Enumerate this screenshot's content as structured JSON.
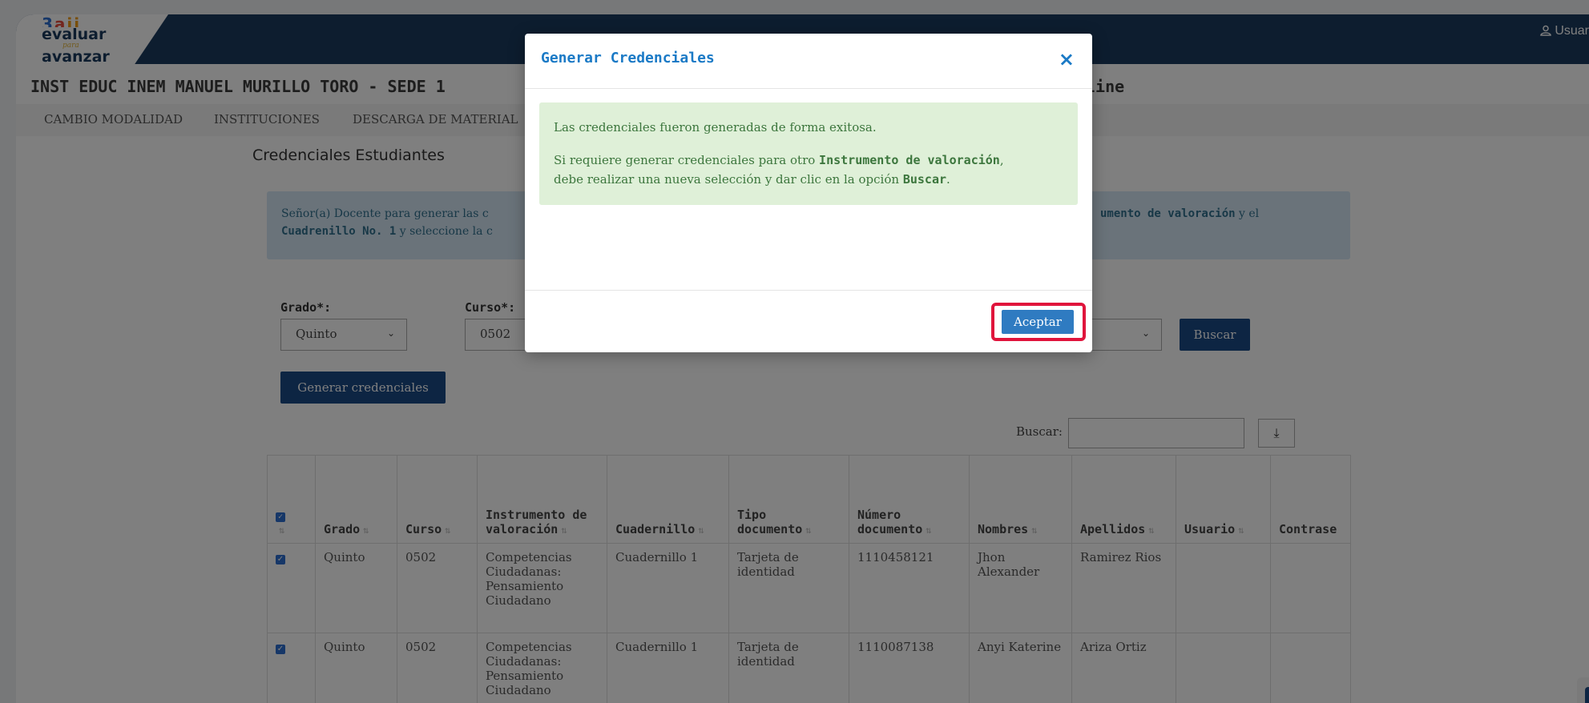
{
  "app": {
    "logo": {
      "dots": "3 a ii",
      "line1": "evaluar",
      "line2": "para",
      "line3": "avanzar"
    },
    "user_label": "Usuar",
    "institution": "INST EDUC INEM MANUEL MURILLO TORO - SEDE 1",
    "institution_suffix": "line"
  },
  "nav": {
    "items": [
      "CAMBIO MODALIDAD",
      "INSTITUCIONES",
      "DESCARGA DE MATERIAL"
    ]
  },
  "page": {
    "title": "Credenciales Estudiantes",
    "info": {
      "line1_start": "Señor(a) Docente para generar las c",
      "line1_end_bold": "umento de valoración",
      "line1_end": " y el",
      "line2_bold": "Cuadrenillo No. 1",
      "line2": " y seleccione la c"
    }
  },
  "form": {
    "grado_label": "Grado*:",
    "grado_value": "Quinto",
    "curso_label": "Curso*:",
    "curso_value": "0502",
    "buscar_button": "Buscar",
    "generate_button": "Generar credenciales"
  },
  "table_search": {
    "label": "Buscar:",
    "value": ""
  },
  "table": {
    "headers": [
      "Grado",
      "Curso",
      "Instrumento de valoración",
      "Cuadernillo",
      "Tipo documento",
      "Número documento",
      "Nombres",
      "Apellidos",
      "Usuario",
      "Contrase"
    ],
    "rows": [
      {
        "checked": true,
        "grado": "Quinto",
        "curso": "0502",
        "instrumento": "Competencias Ciudadanas: Pensamiento Ciudadano",
        "cuadernillo": "Cuadernillo 1",
        "tipo": "Tarjeta de identidad",
        "numero": "1110458121",
        "nombres": "Jhon Alexander",
        "apellidos": "Ramirez Rios",
        "usuario": "",
        "contrasena": ""
      },
      {
        "checked": true,
        "grado": "Quinto",
        "curso": "0502",
        "instrumento": "Competencias Ciudadanas: Pensamiento Ciudadano",
        "cuadernillo": "Cuadernillo 1",
        "tipo": "Tarjeta de identidad",
        "numero": "1110087138",
        "nombres": "Anyi Katerine",
        "apellidos": "Ariza Ortiz",
        "usuario": "",
        "contrasena": ""
      }
    ]
  },
  "modal": {
    "title": "Generar Credenciales",
    "close": "×",
    "success_line1": "Las credenciales fueron generadas de forma exitosa.",
    "success_line2_start": "Si requiere generar credenciales para otro ",
    "success_line2_bold": "Instrumento de valoración",
    "success_line2_end": ",",
    "success_line3_start": "debe realizar una nueva selección y dar clic en la opción ",
    "success_line3_bold": "Buscar",
    "success_line3_end": ".",
    "accept_button": "Aceptar"
  },
  "colors": {
    "topbar": "#1b3a5e",
    "primary_button": "#1b4a86",
    "modal_title": "#1b7ac6",
    "success_bg": "#dff0d8",
    "highlight": "#e0143c"
  }
}
